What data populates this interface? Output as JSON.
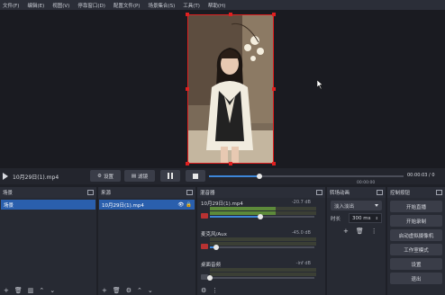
{
  "menubar": [
    "文件(F)",
    "编辑(E)",
    "视图(V)",
    "停靠窗口(D)",
    "配置文件(P)",
    "场景集合(S)",
    "工具(T)",
    "帮助(H)"
  ],
  "media": {
    "filename": "10月29日(1).mp4",
    "settings_label": "设置",
    "filters_label": "滤镜",
    "time_elapsed": "00:00:00",
    "time_current": "00:00:03 / 0",
    "seek_progress": 0.26
  },
  "scenes": {
    "title": "场景",
    "items": [
      "场景"
    ]
  },
  "sources": {
    "title": "来源",
    "items": [
      "10月29日(1).mp4"
    ]
  },
  "mixer": {
    "title": "混音器",
    "channels": [
      {
        "name": "10月29日(1).mp4",
        "db": "-20.7 dB",
        "muted": true,
        "level": 0.62,
        "volume": 0.48
      },
      {
        "name": "麦克风/Aux",
        "db": "-45.0 dB",
        "muted": true,
        "level": 0,
        "volume": 0.06
      },
      {
        "name": "桌面音频",
        "db": "-inf dB",
        "muted": false,
        "level": 0,
        "volume": 0
      }
    ]
  },
  "transitions": {
    "title": "转场动画",
    "selected": "淡入淡出",
    "duration_label": "时长",
    "duration_value": "300 ms"
  },
  "controls": {
    "title": "控制按钮",
    "buttons": [
      "开始直播",
      "开始录制",
      "启动虚拟摄像机",
      "工作室模式",
      "设置",
      "退出"
    ]
  },
  "colors": {
    "accent": "#3d86d8",
    "selection": "#2a5fad",
    "bounding_box": "#e02020",
    "mute": "#b83232"
  }
}
